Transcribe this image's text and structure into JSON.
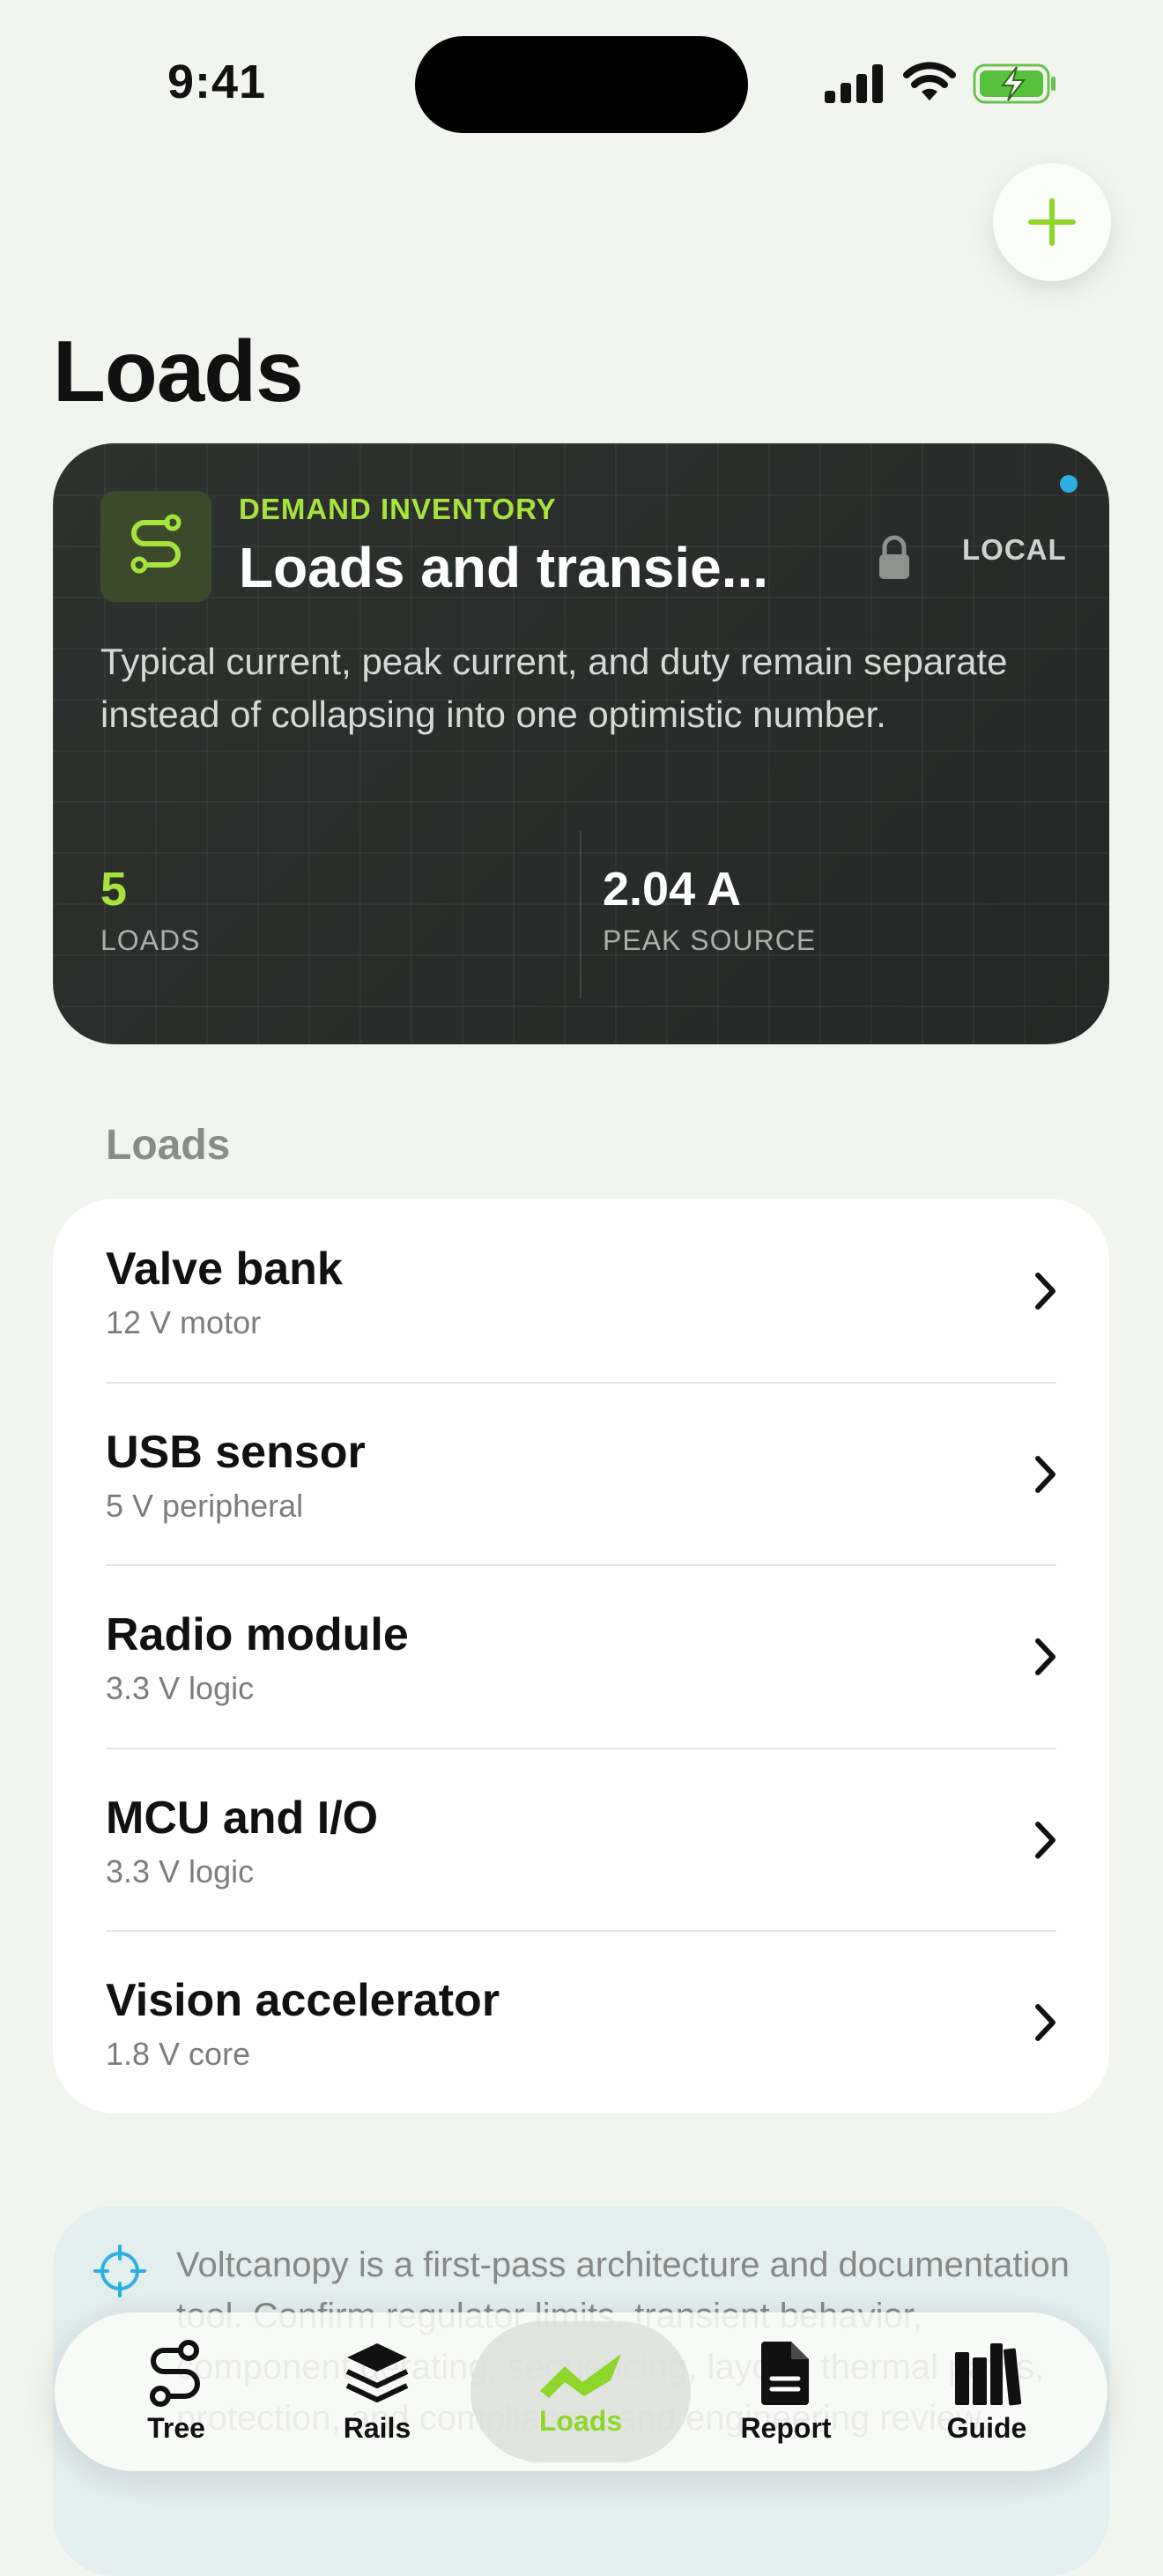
{
  "status_bar": {
    "time": "9:41"
  },
  "page": {
    "title": "Loads"
  },
  "hero": {
    "eyebrow": "DEMAND INVENTORY",
    "title": "Loads and transie...",
    "badge": "LOCAL",
    "description": "Typical current, peak current, and duty remain separate instead of collapsing into one optimistic number.",
    "stats": [
      {
        "value": "5",
        "label": "LOADS"
      },
      {
        "value": "2.04 A",
        "label": "PEAK SOURCE"
      }
    ]
  },
  "section": {
    "label": "Loads"
  },
  "loads": [
    {
      "name": "Valve bank",
      "detail": "12 V motor"
    },
    {
      "name": "USB sensor",
      "detail": "5 V peripheral"
    },
    {
      "name": "Radio module",
      "detail": "3.3 V logic"
    },
    {
      "name": "MCU and I/O",
      "detail": "3.3 V logic"
    },
    {
      "name": "Vision accelerator",
      "detail": "1.8 V core"
    }
  ],
  "notice": {
    "text": "Voltcanopy is a first-pass architecture and documentation tool. Confirm regulator limits, transient behavior, component derating, sequencing, layout, thermal paths, protection, and compliance, and engineering review."
  },
  "tabs": [
    {
      "label": "Tree",
      "icon": "tree-icon",
      "active": false
    },
    {
      "label": "Rails",
      "icon": "rails-icon",
      "active": false
    },
    {
      "label": "Loads",
      "icon": "loads-icon",
      "active": true
    },
    {
      "label": "Report",
      "icon": "report-icon",
      "active": false
    },
    {
      "label": "Guide",
      "icon": "guide-icon",
      "active": false
    }
  ],
  "colors": {
    "accent": "#a6e43c",
    "card": "#2b2f2c",
    "info": "#2eaee2"
  }
}
